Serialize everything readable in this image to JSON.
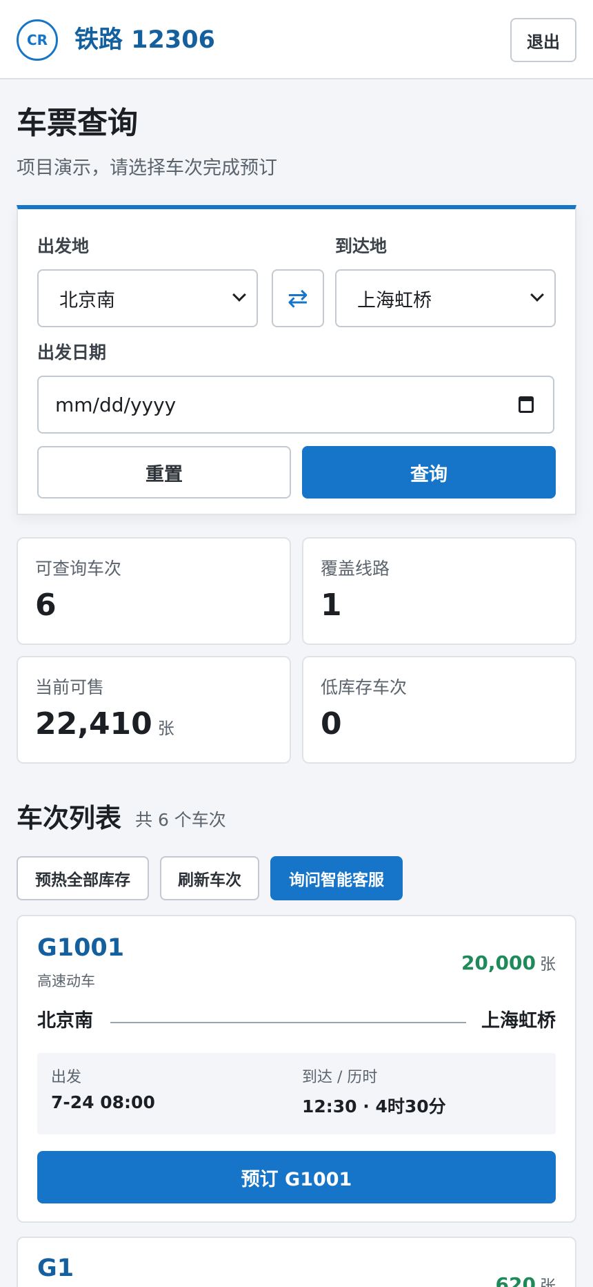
{
  "header": {
    "logo": "CR",
    "brand": "铁路 12306",
    "logout_label": "退出"
  },
  "page": {
    "title": "车票查询",
    "subtitle": "项目演示，请选择车次完成预订"
  },
  "search": {
    "from_label": "出发地",
    "from_value": "北京南",
    "to_label": "到达地",
    "to_value": "上海虹桥",
    "swap_icon": "⇄",
    "date_label": "出发日期",
    "date_placeholder": "mm/dd/yyyy",
    "reset_label": "重置",
    "query_label": "查询"
  },
  "stats": [
    {
      "label": "可查询车次",
      "value": "6",
      "unit": ""
    },
    {
      "label": "覆盖线路",
      "value": "1",
      "unit": ""
    },
    {
      "label": "当前可售",
      "value": "22,410",
      "unit": "张"
    },
    {
      "label": "低库存车次",
      "value": "0",
      "unit": ""
    }
  ],
  "list": {
    "title": "车次列表",
    "count_text": "共 6 个车次",
    "actions": [
      "预热全部库存",
      "刷新车次",
      "询问智能客服"
    ]
  },
  "trains": [
    {
      "number": "G1001",
      "type": "高速动车",
      "tickets": "20,000",
      "ticket_unit": "张",
      "from": "北京南",
      "to": "上海虹桥",
      "depart_label": "出发",
      "depart_value": "7-24 08:00",
      "arrive_label": "到达 / 历时",
      "arrive_value": "12:30 · 4时30分",
      "book_label": "预订 G1001"
    },
    {
      "number": "G1",
      "tickets": "620",
      "ticket_unit": "张"
    }
  ],
  "colors": {
    "accent": "#1675c8",
    "brand": "#14609f",
    "success": "#1e8a5a"
  }
}
